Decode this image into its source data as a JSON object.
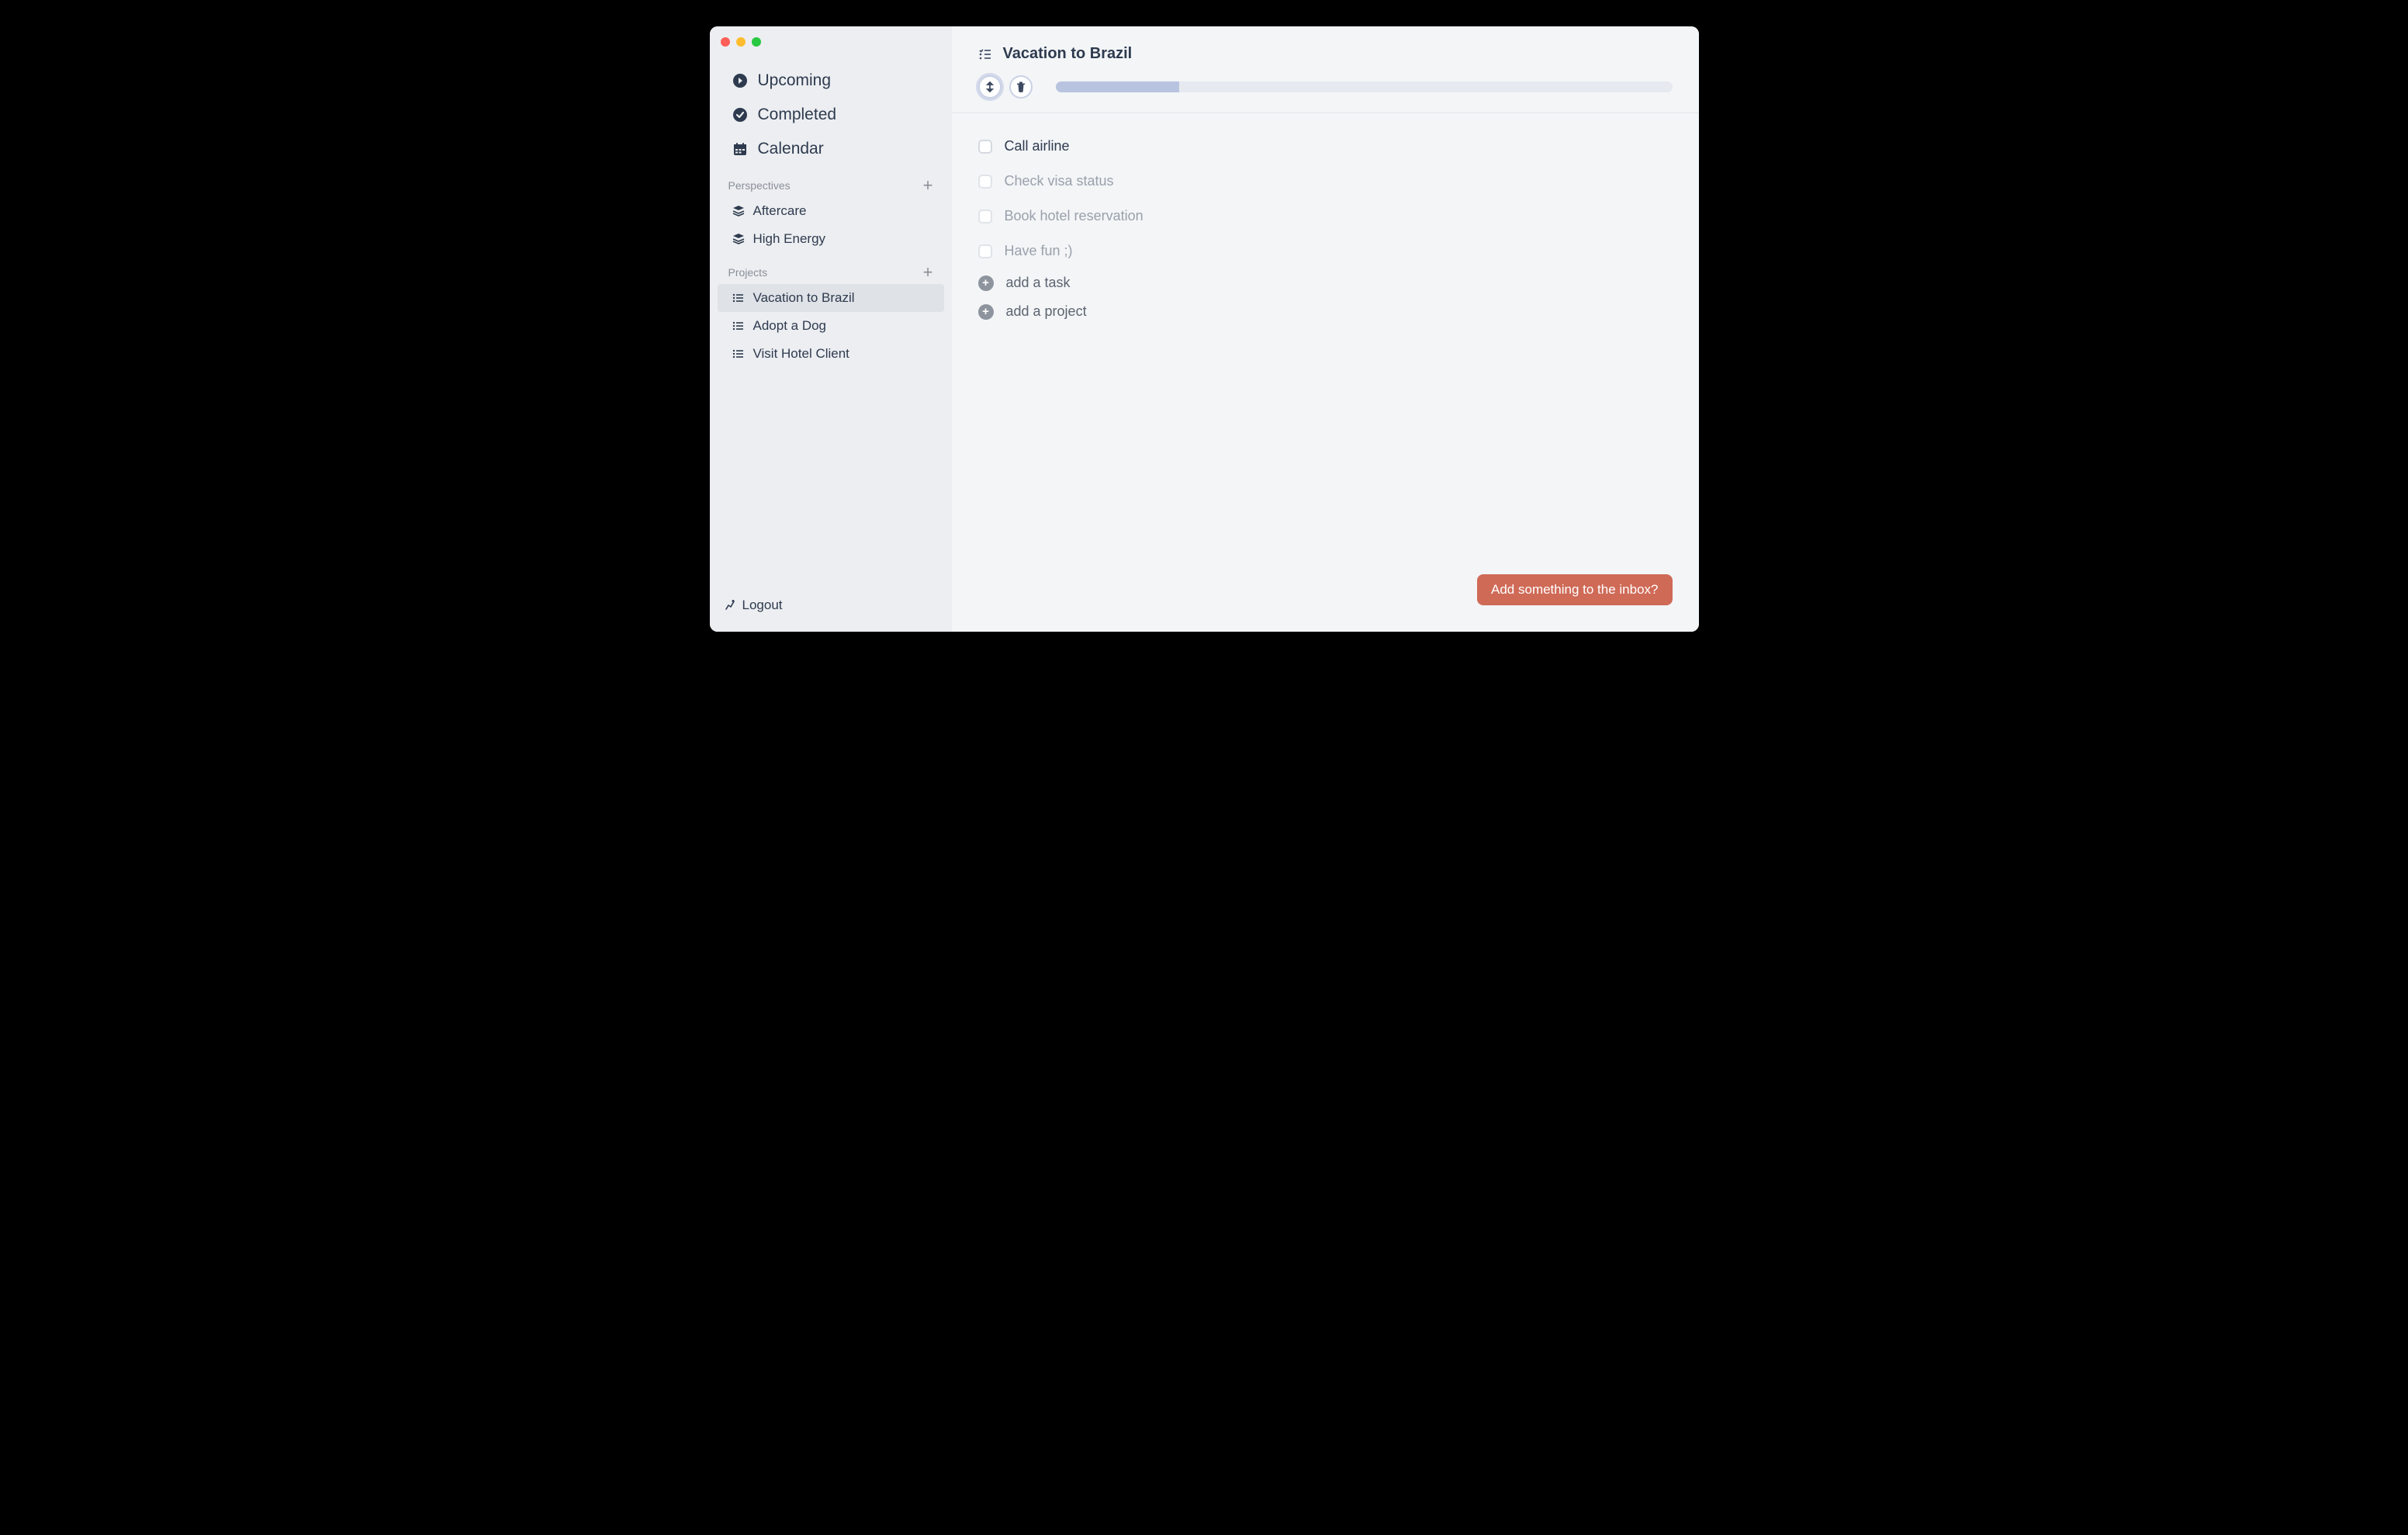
{
  "sidebar": {
    "nav": [
      {
        "label": "Upcoming",
        "icon": "chevron-circle"
      },
      {
        "label": "Completed",
        "icon": "check-circle"
      },
      {
        "label": "Calendar",
        "icon": "calendar"
      }
    ],
    "perspectives_header": "Perspectives",
    "perspectives": [
      {
        "label": "Aftercare"
      },
      {
        "label": "High Energy"
      }
    ],
    "projects_header": "Projects",
    "projects": [
      {
        "label": "Vacation to Brazil",
        "active": true
      },
      {
        "label": "Adopt a Dog"
      },
      {
        "label": "Visit Hotel Client"
      }
    ],
    "logout_label": "Logout"
  },
  "main": {
    "title": "Vacation to Brazil",
    "progress_pct": 20,
    "tasks": [
      {
        "label": "Call airline",
        "dimmed": false
      },
      {
        "label": "Check visa status",
        "dimmed": true
      },
      {
        "label": "Book hotel reservation",
        "dimmed": true
      },
      {
        "label": "Have fun ;)",
        "dimmed": true
      }
    ],
    "add_task_label": "add a task",
    "add_project_label": "add a project"
  },
  "inbox_prompt": "Add something to the inbox?"
}
